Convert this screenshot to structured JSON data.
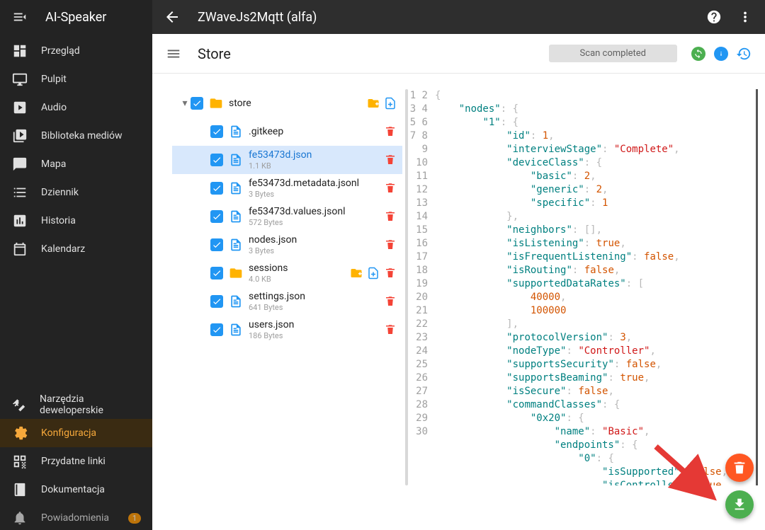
{
  "sidebar": {
    "title": "AI-Speaker",
    "items": [
      {
        "label": "Przegląd"
      },
      {
        "label": "Pulpit"
      },
      {
        "label": "Audio"
      },
      {
        "label": "Biblioteka mediów"
      },
      {
        "label": "Mapa"
      },
      {
        "label": "Dziennik"
      },
      {
        "label": "Historia"
      },
      {
        "label": "Kalendarz"
      }
    ],
    "bottom": [
      {
        "label": "Narzędzia deweloperskie"
      },
      {
        "label": "Konfiguracja"
      },
      {
        "label": "Przydatne linki"
      },
      {
        "label": "Dokumentacja"
      },
      {
        "label": "Powiadomienia",
        "badge": "1"
      }
    ]
  },
  "topbar": {
    "title": "ZWaveJs2Mqtt (alfa)"
  },
  "subbar": {
    "title": "Store",
    "scan_label": "Scan completed"
  },
  "tree": {
    "root": "store",
    "items": [
      {
        "name": ".gitkeep",
        "size": "",
        "type": "file"
      },
      {
        "name": "fe53473d.json",
        "size": "1.1 KB",
        "type": "file",
        "selected": true
      },
      {
        "name": "fe53473d.metadata.jsonl",
        "size": "3 Bytes",
        "type": "file"
      },
      {
        "name": "fe53473d.values.jsonl",
        "size": "572 Bytes",
        "type": "file"
      },
      {
        "name": "nodes.json",
        "size": "3 Bytes",
        "type": "file"
      },
      {
        "name": "sessions",
        "size": "4.0 KB",
        "type": "folder"
      },
      {
        "name": "settings.json",
        "size": "641 Bytes",
        "type": "file"
      },
      {
        "name": "users.json",
        "size": "186 Bytes",
        "type": "file"
      }
    ]
  },
  "code": [
    [
      {
        "t": "brace",
        "v": "{"
      }
    ],
    [
      {
        "t": "sp",
        "v": "    "
      },
      {
        "t": "key",
        "v": "\"nodes\""
      },
      {
        "t": "brace",
        "v": ": {"
      }
    ],
    [
      {
        "t": "sp",
        "v": "        "
      },
      {
        "t": "key",
        "v": "\"1\""
      },
      {
        "t": "brace",
        "v": ": {"
      }
    ],
    [
      {
        "t": "sp",
        "v": "            "
      },
      {
        "t": "key",
        "v": "\"id\""
      },
      {
        "t": "brace",
        "v": ": "
      },
      {
        "t": "num",
        "v": "1"
      },
      {
        "t": "comma",
        "v": ","
      }
    ],
    [
      {
        "t": "sp",
        "v": "            "
      },
      {
        "t": "key",
        "v": "\"interviewStage\""
      },
      {
        "t": "brace",
        "v": ": "
      },
      {
        "t": "str",
        "v": "\"Complete\""
      },
      {
        "t": "comma",
        "v": ","
      }
    ],
    [
      {
        "t": "sp",
        "v": "            "
      },
      {
        "t": "key",
        "v": "\"deviceClass\""
      },
      {
        "t": "brace",
        "v": ": {"
      }
    ],
    [
      {
        "t": "sp",
        "v": "                "
      },
      {
        "t": "key",
        "v": "\"basic\""
      },
      {
        "t": "brace",
        "v": ": "
      },
      {
        "t": "num",
        "v": "2"
      },
      {
        "t": "comma",
        "v": ","
      }
    ],
    [
      {
        "t": "sp",
        "v": "                "
      },
      {
        "t": "key",
        "v": "\"generic\""
      },
      {
        "t": "brace",
        "v": ": "
      },
      {
        "t": "num",
        "v": "2"
      },
      {
        "t": "comma",
        "v": ","
      }
    ],
    [
      {
        "t": "sp",
        "v": "                "
      },
      {
        "t": "key",
        "v": "\"specific\""
      },
      {
        "t": "brace",
        "v": ": "
      },
      {
        "t": "num",
        "v": "1"
      }
    ],
    [
      {
        "t": "sp",
        "v": "            "
      },
      {
        "t": "brace",
        "v": "}"
      },
      {
        "t": "comma",
        "v": ","
      }
    ],
    [
      {
        "t": "sp",
        "v": "            "
      },
      {
        "t": "key",
        "v": "\"neighbors\""
      },
      {
        "t": "brace",
        "v": ": []"
      },
      {
        "t": "comma",
        "v": ","
      }
    ],
    [
      {
        "t": "sp",
        "v": "            "
      },
      {
        "t": "key",
        "v": "\"isListening\""
      },
      {
        "t": "brace",
        "v": ": "
      },
      {
        "t": "bool",
        "v": "true"
      },
      {
        "t": "comma",
        "v": ","
      }
    ],
    [
      {
        "t": "sp",
        "v": "            "
      },
      {
        "t": "key",
        "v": "\"isFrequentListening\""
      },
      {
        "t": "brace",
        "v": ": "
      },
      {
        "t": "bool",
        "v": "false"
      },
      {
        "t": "comma",
        "v": ","
      }
    ],
    [
      {
        "t": "sp",
        "v": "            "
      },
      {
        "t": "key",
        "v": "\"isRouting\""
      },
      {
        "t": "brace",
        "v": ": "
      },
      {
        "t": "bool",
        "v": "false"
      },
      {
        "t": "comma",
        "v": ","
      }
    ],
    [
      {
        "t": "sp",
        "v": "            "
      },
      {
        "t": "key",
        "v": "\"supportedDataRates\""
      },
      {
        "t": "brace",
        "v": ": ["
      }
    ],
    [
      {
        "t": "sp",
        "v": "                "
      },
      {
        "t": "num",
        "v": "40000"
      },
      {
        "t": "comma",
        "v": ","
      }
    ],
    [
      {
        "t": "sp",
        "v": "                "
      },
      {
        "t": "num",
        "v": "100000"
      }
    ],
    [
      {
        "t": "sp",
        "v": "            "
      },
      {
        "t": "brace",
        "v": "]"
      },
      {
        "t": "comma",
        "v": ","
      }
    ],
    [
      {
        "t": "sp",
        "v": "            "
      },
      {
        "t": "key",
        "v": "\"protocolVersion\""
      },
      {
        "t": "brace",
        "v": ": "
      },
      {
        "t": "num",
        "v": "3"
      },
      {
        "t": "comma",
        "v": ","
      }
    ],
    [
      {
        "t": "sp",
        "v": "            "
      },
      {
        "t": "key",
        "v": "\"nodeType\""
      },
      {
        "t": "brace",
        "v": ": "
      },
      {
        "t": "str",
        "v": "\"Controller\""
      },
      {
        "t": "comma",
        "v": ","
      }
    ],
    [
      {
        "t": "sp",
        "v": "            "
      },
      {
        "t": "key",
        "v": "\"supportsSecurity\""
      },
      {
        "t": "brace",
        "v": ": "
      },
      {
        "t": "bool",
        "v": "false"
      },
      {
        "t": "comma",
        "v": ","
      }
    ],
    [
      {
        "t": "sp",
        "v": "            "
      },
      {
        "t": "key",
        "v": "\"supportsBeaming\""
      },
      {
        "t": "brace",
        "v": ": "
      },
      {
        "t": "bool",
        "v": "true"
      },
      {
        "t": "comma",
        "v": ","
      }
    ],
    [
      {
        "t": "sp",
        "v": "            "
      },
      {
        "t": "key",
        "v": "\"isSecure\""
      },
      {
        "t": "brace",
        "v": ": "
      },
      {
        "t": "bool",
        "v": "false"
      },
      {
        "t": "comma",
        "v": ","
      }
    ],
    [
      {
        "t": "sp",
        "v": "            "
      },
      {
        "t": "key",
        "v": "\"commandClasses\""
      },
      {
        "t": "brace",
        "v": ": {"
      }
    ],
    [
      {
        "t": "sp",
        "v": "                "
      },
      {
        "t": "key",
        "v": "\"0x20\""
      },
      {
        "t": "brace",
        "v": ": {"
      }
    ],
    [
      {
        "t": "sp",
        "v": "                    "
      },
      {
        "t": "key",
        "v": "\"name\""
      },
      {
        "t": "brace",
        "v": ": "
      },
      {
        "t": "str",
        "v": "\"Basic\""
      },
      {
        "t": "comma",
        "v": ","
      }
    ],
    [
      {
        "t": "sp",
        "v": "                    "
      },
      {
        "t": "key",
        "v": "\"endpoints\""
      },
      {
        "t": "brace",
        "v": ": {"
      }
    ],
    [
      {
        "t": "sp",
        "v": "                        "
      },
      {
        "t": "key",
        "v": "\"0\""
      },
      {
        "t": "brace",
        "v": ": {"
      }
    ],
    [
      {
        "t": "sp",
        "v": "                            "
      },
      {
        "t": "key",
        "v": "\"isSupported\""
      },
      {
        "t": "brace",
        "v": ": "
      },
      {
        "t": "bool",
        "v": "false"
      },
      {
        "t": "comma",
        "v": ","
      }
    ],
    [
      {
        "t": "sp",
        "v": "                            "
      },
      {
        "t": "key",
        "v": "\"isControlled\""
      },
      {
        "t": "brace",
        "v": ": "
      },
      {
        "t": "bool",
        "v": "true"
      },
      {
        "t": "comma",
        "v": ","
      }
    ]
  ]
}
